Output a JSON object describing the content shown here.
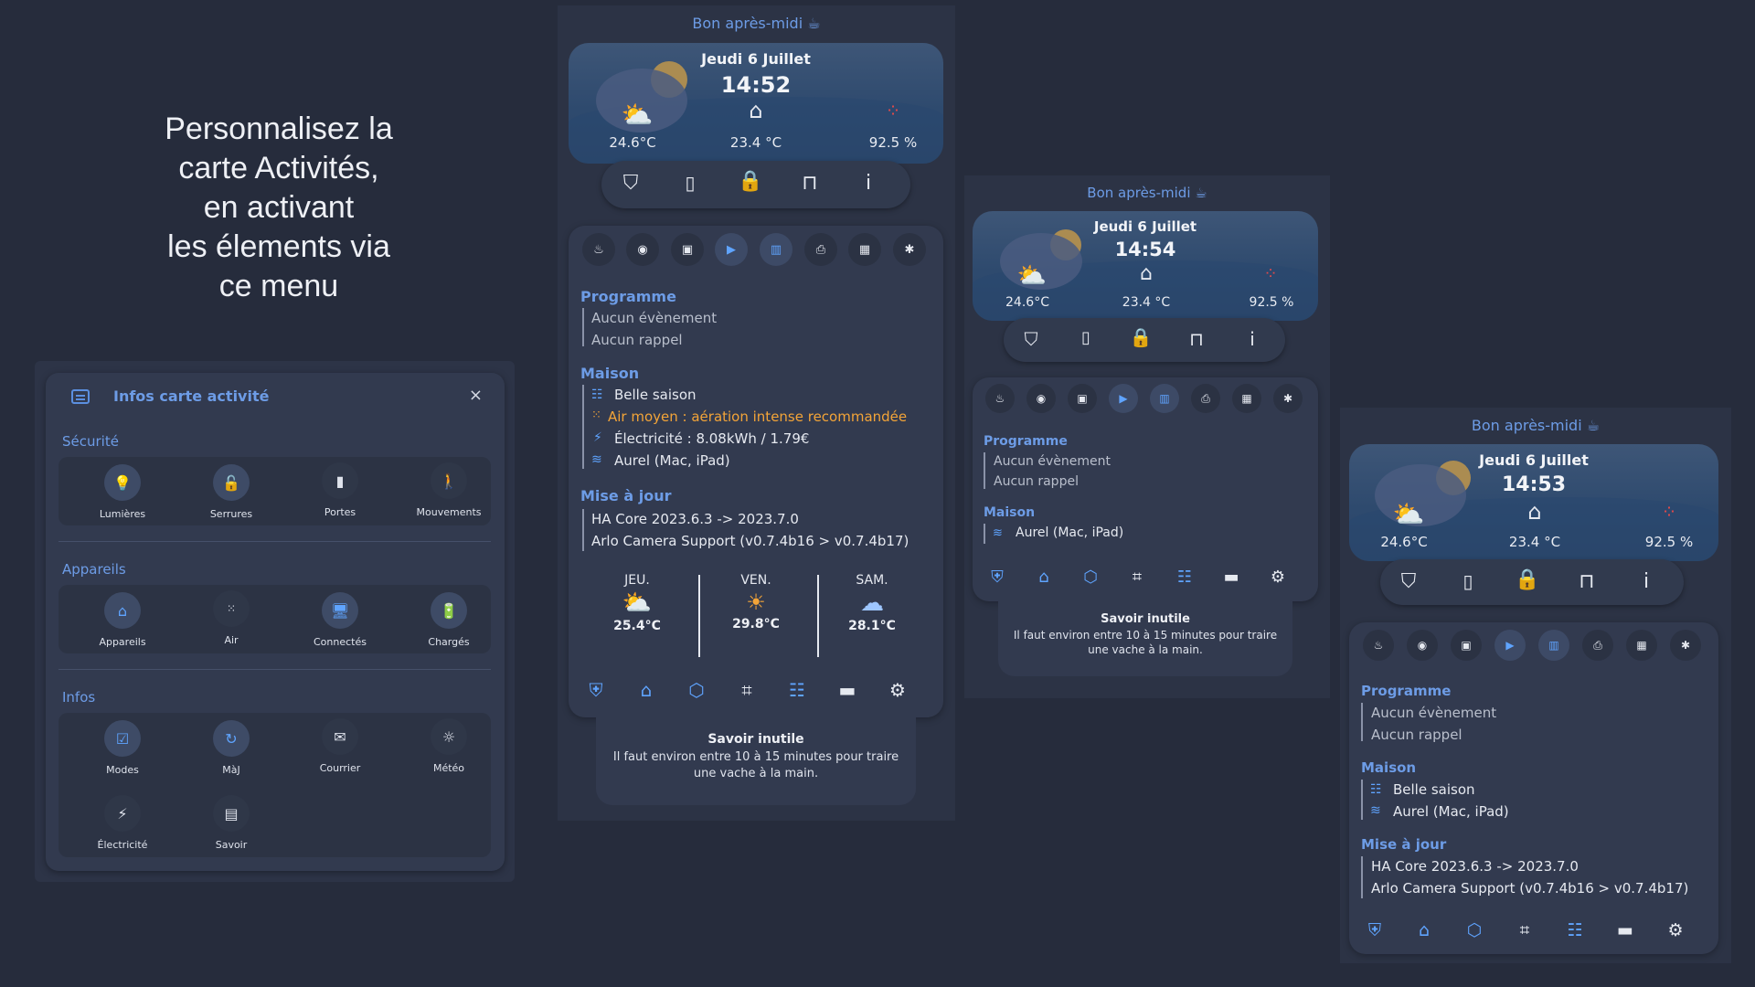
{
  "headline": [
    "Personnalisez la",
    "carte Activités,",
    "en activant",
    "les élements via",
    "ce menu"
  ],
  "menu": {
    "title": "Infos carte activité",
    "close": "×",
    "sections": [
      {
        "label": "Sécurité",
        "items": [
          {
            "label": "Lumières",
            "icon": "bulb-icon",
            "on": true
          },
          {
            "label": "Serrures",
            "icon": "lock-open-icon",
            "on": true
          },
          {
            "label": "Portes",
            "icon": "door-icon",
            "on": false
          },
          {
            "label": "Mouvements",
            "icon": "walk-icon",
            "on": false
          }
        ]
      },
      {
        "label": "Appareils",
        "items": [
          {
            "label": "Appareils",
            "icon": "home-icon",
            "on": true
          },
          {
            "label": "Air",
            "icon": "air-icon",
            "on": false
          },
          {
            "label": "Connectés",
            "icon": "monitor-icon",
            "on": true
          },
          {
            "label": "Chargés",
            "icon": "battery-charging-icon",
            "on": true
          }
        ]
      },
      {
        "label": "Infos",
        "items": [
          {
            "label": "Modes",
            "icon": "checklist-icon",
            "on": true
          },
          {
            "label": "MàJ",
            "icon": "update-icon",
            "on": true
          },
          {
            "label": "Courrier",
            "icon": "mail-icon",
            "on": false
          },
          {
            "label": "Météo",
            "icon": "weather-icon",
            "on": false
          },
          {
            "label": "Électricité",
            "icon": "flash-icon",
            "on": false
          },
          {
            "label": "Savoir",
            "icon": "newspaper-icon",
            "on": false
          }
        ]
      }
    ]
  },
  "card1": {
    "greeting": "Bon après-midi ☕",
    "date": "Jeudi 6 Juillet",
    "time": "14:52",
    "outdoor_temp": "24.6°C",
    "indoor_temp": "23.4 °C",
    "humidity": "92.5 %",
    "programme_title": "Programme",
    "programme": [
      "Aucun évènement",
      "Aucun rappel"
    ],
    "maison_title": "Maison",
    "maison": [
      "Belle saison",
      "Air moyen : aération intense recommandée",
      "Électricité : 8.08kWh / 1.79€",
      "Aurel (Mac, iPad)"
    ],
    "maj_title": "Mise à jour",
    "maj": [
      "HA Core 2023.6.3 -> 2023.7.0",
      "Arlo Camera Support (v0.7.4b16 > v0.7.4b17)"
    ],
    "forecast": [
      {
        "day": "JEU.",
        "temp": "25.4°C",
        "icon": "partly-sunny-icon"
      },
      {
        "day": "VEN.",
        "temp": "29.8°C",
        "icon": "sun-icon"
      },
      {
        "day": "SAM.",
        "temp": "28.1°C",
        "icon": "cloud-icon"
      }
    ],
    "tip_title": "Savoir inutile",
    "tip_text_1": "Il faut environ entre 10 à 15 minutes pour traire",
    "tip_text_2": "une vache à la main."
  },
  "card2": {
    "greeting": "Bon après-midi ☕",
    "date": "Jeudi 6 Juillet",
    "time": "14:54",
    "outdoor_temp": "24.6°C",
    "indoor_temp": "23.4 °C",
    "humidity": "92.5 %",
    "programme_title": "Programme",
    "programme": [
      "Aucun évènement",
      "Aucun rappel"
    ],
    "maison_title": "Maison",
    "maison": [
      "Aurel (Mac, iPad)"
    ],
    "tip_title": "Savoir inutile",
    "tip_text_1": "Il faut environ entre 10 à 15 minutes pour traire",
    "tip_text_2": "une vache à la main."
  },
  "card3": {
    "greeting": "Bon après-midi ☕",
    "date": "Jeudi 6 Juillet",
    "time": "14:53",
    "outdoor_temp": "24.6°C",
    "indoor_temp": "23.4 °C",
    "humidity": "92.5 %",
    "programme_title": "Programme",
    "programme": [
      "Aucun évènement",
      "Aucun rappel"
    ],
    "maison_title": "Maison",
    "maison": [
      "Belle saison",
      "Aurel (Mac, iPad)"
    ],
    "maj_title": "Mise à jour",
    "maj": [
      "HA Core 2023.6.3 -> 2023.7.0",
      "Arlo Camera Support (v0.7.4b16 > v0.7.4b17)"
    ]
  },
  "colors": {
    "background": "#262c3c",
    "accent": "#6d9ce6",
    "warning": "#f3a438",
    "icon_on": "#5fa4ff"
  }
}
